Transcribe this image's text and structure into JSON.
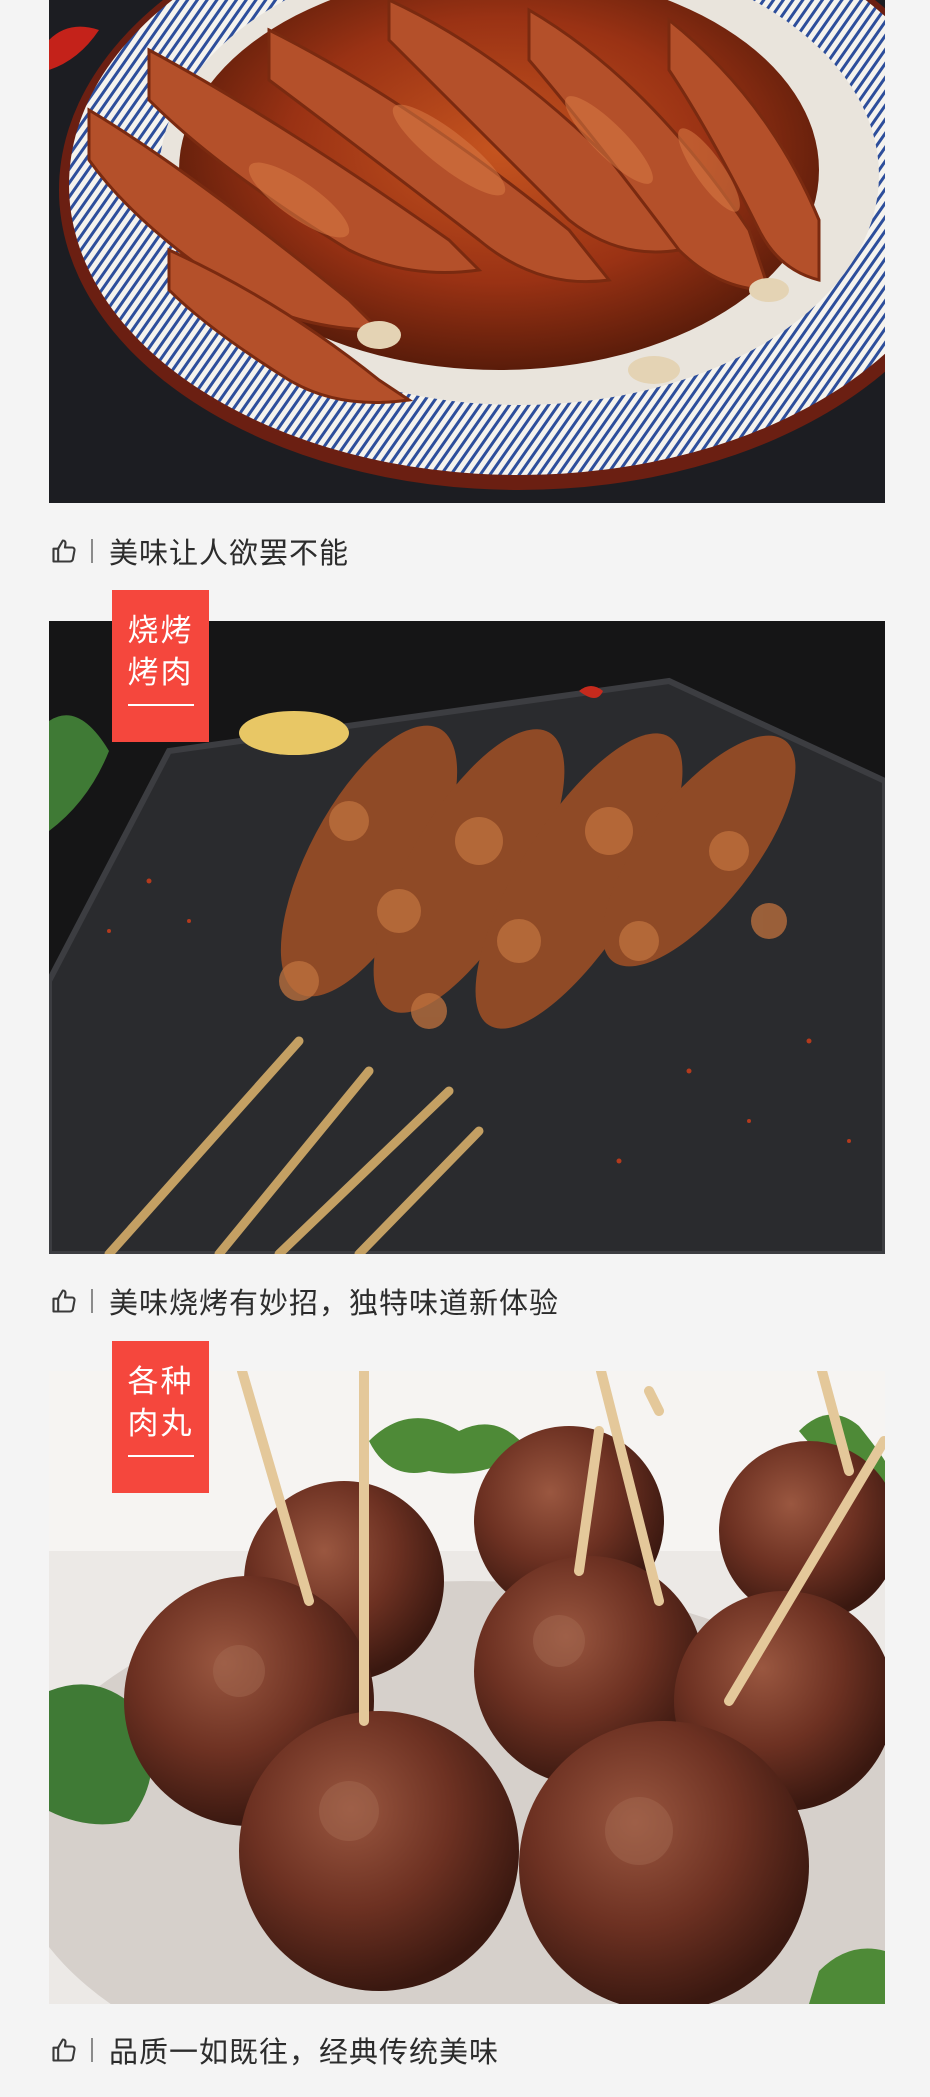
{
  "sections": [
    {
      "caption": "美味让人欲罢不能",
      "tag_lines": []
    },
    {
      "caption": "美味烧烤有妙招，独特味道新体验",
      "tag_lines": [
        "烧烤",
        "烤肉"
      ]
    },
    {
      "caption": "品质一如既往，经典传统美味",
      "tag_lines": [
        "各种",
        "肉丸"
      ]
    }
  ],
  "icons": {
    "caption_icon": "thumbs-up-icon"
  },
  "colors": {
    "tag_bg": "#f5473d",
    "background": "#f4f4f4",
    "text": "#2c2c2c"
  }
}
